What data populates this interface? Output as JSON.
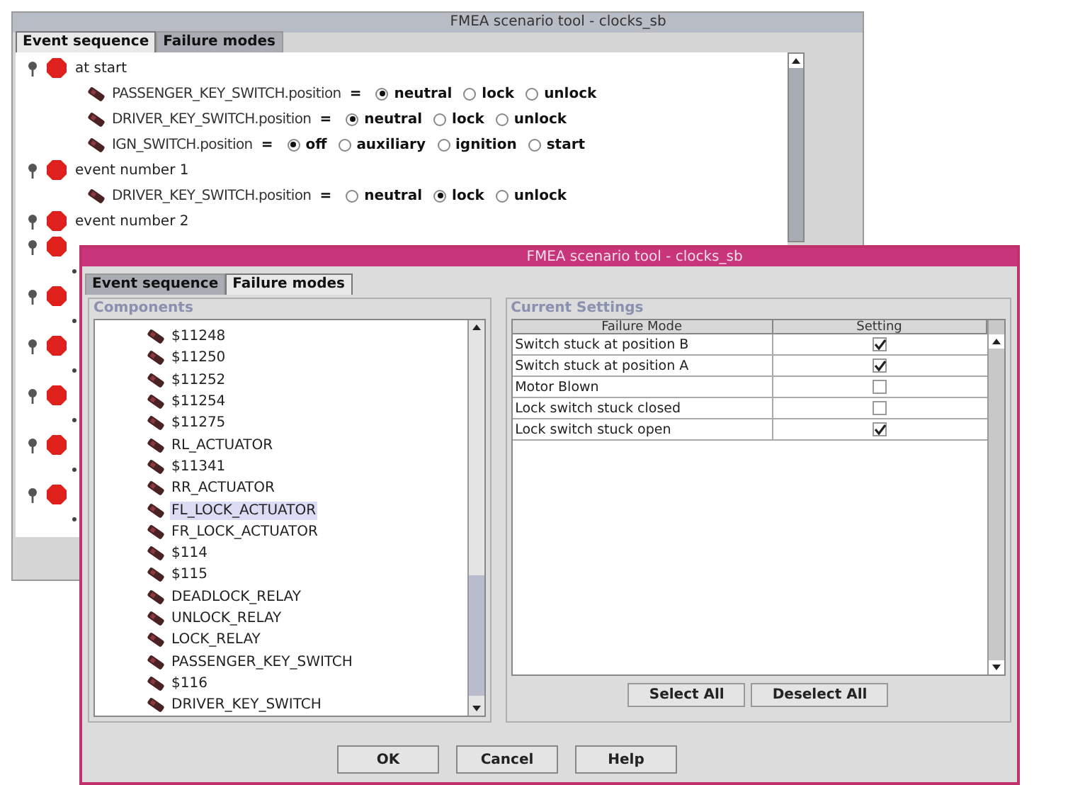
{
  "back_window": {
    "title": "FMEA scenario tool - clocks_sb",
    "tabs": [
      {
        "label": "Event sequence",
        "selected": true
      },
      {
        "label": "Failure modes",
        "selected": false
      }
    ],
    "events": [
      {
        "label": "at start",
        "settings": [
          {
            "name": "PASSENGER_KEY_SWITCH.position",
            "operator": "=",
            "options": [
              {
                "label": "neutral",
                "selected": true
              },
              {
                "label": "lock",
                "selected": false
              },
              {
                "label": "unlock",
                "selected": false
              }
            ]
          },
          {
            "name": "DRIVER_KEY_SWITCH.position",
            "operator": "=",
            "options": [
              {
                "label": "neutral",
                "selected": true
              },
              {
                "label": "lock",
                "selected": false
              },
              {
                "label": "unlock",
                "selected": false
              }
            ]
          },
          {
            "name": "IGN_SWITCH.position",
            "operator": "=",
            "options": [
              {
                "label": "off",
                "selected": true
              },
              {
                "label": "auxiliary",
                "selected": false
              },
              {
                "label": "ignition",
                "selected": false
              },
              {
                "label": "start",
                "selected": false
              }
            ]
          }
        ]
      },
      {
        "label": "event number 1",
        "settings": [
          {
            "name": "DRIVER_KEY_SWITCH.position",
            "operator": "=",
            "options": [
              {
                "label": "neutral",
                "selected": false
              },
              {
                "label": "lock",
                "selected": true
              },
              {
                "label": "unlock",
                "selected": false
              }
            ]
          }
        ]
      },
      {
        "label": "event number 2"
      }
    ]
  },
  "front_window": {
    "title": "FMEA scenario tool - clocks_sb",
    "tabs": [
      {
        "label": "Event sequence",
        "selected": false
      },
      {
        "label": "Failure modes",
        "selected": true
      }
    ],
    "components": {
      "title": "Components",
      "items": [
        {
          "label": "$11248",
          "selected": false
        },
        {
          "label": "$11250",
          "selected": false
        },
        {
          "label": "$11252",
          "selected": false
        },
        {
          "label": "$11254",
          "selected": false
        },
        {
          "label": "$11275",
          "selected": false
        },
        {
          "label": "RL_ACTUATOR",
          "selected": false
        },
        {
          "label": "$11341",
          "selected": false
        },
        {
          "label": "RR_ACTUATOR",
          "selected": false
        },
        {
          "label": "FL_LOCK_ACTUATOR",
          "selected": true
        },
        {
          "label": "FR_LOCK_ACTUATOR",
          "selected": false
        },
        {
          "label": "$114",
          "selected": false
        },
        {
          "label": "$115",
          "selected": false
        },
        {
          "label": "DEADLOCK_RELAY",
          "selected": false
        },
        {
          "label": "UNLOCK_RELAY",
          "selected": false
        },
        {
          "label": "LOCK_RELAY",
          "selected": false
        },
        {
          "label": "PASSENGER_KEY_SWITCH",
          "selected": false
        },
        {
          "label": "$116",
          "selected": false
        },
        {
          "label": "DRIVER_KEY_SWITCH",
          "selected": false
        }
      ]
    },
    "current_settings": {
      "title": "Current Settings",
      "columns": [
        "Failure Mode",
        "Setting"
      ],
      "rows": [
        {
          "failure_mode": "Switch stuck at position B",
          "checked": true
        },
        {
          "failure_mode": "Switch stuck at position A",
          "checked": true
        },
        {
          "failure_mode": "Motor Blown",
          "checked": false
        },
        {
          "failure_mode": "Lock switch stuck closed",
          "checked": false
        },
        {
          "failure_mode": "Lock switch stuck open",
          "checked": true
        }
      ]
    },
    "select_buttons": [
      "Select All",
      "Deselect All"
    ],
    "buttons": [
      "OK",
      "Cancel",
      "Help"
    ]
  }
}
